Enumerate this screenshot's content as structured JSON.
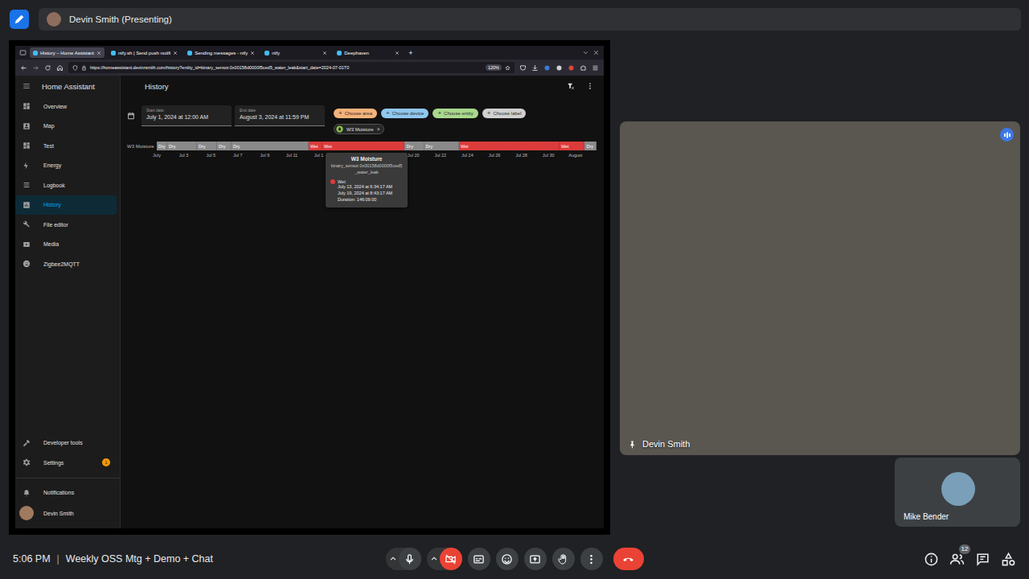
{
  "meet": {
    "presenter_chip": {
      "label": "Devin Smith (Presenting)"
    },
    "tiles": [
      {
        "name": "Devin Smith",
        "pinned": true,
        "speaking": true
      },
      {
        "name": "Mike Bender",
        "pinned": false,
        "speaking": false
      }
    ],
    "bottom_bar": {
      "time": "5:06 PM",
      "separator": "|",
      "meeting_title": "Weekly OSS Mtg + Demo + Chat",
      "mic_on": true,
      "camera_on": false,
      "participants_count": "12"
    }
  },
  "browser": {
    "tabs": [
      {
        "label": "History – Home Assistant",
        "selected": true
      },
      {
        "label": "ntfy.sh | Send push notifi",
        "selected": false
      },
      {
        "label": "Sending messages - ntfy",
        "selected": false
      },
      {
        "label": "ntfy",
        "selected": false
      },
      {
        "label": "Deephaven",
        "selected": false
      }
    ],
    "new_tab": "+",
    "url": "https://homeassistant.devinrsmith.com/history?entity_id=binary_sensor.0x00158d0000f5ced5_water_leak&start_date=2024-07-01T0",
    "zoom": "120%"
  },
  "home_assistant": {
    "title": "Home Assistant",
    "sidebar": {
      "items": [
        {
          "label": "Overview",
          "selected": false
        },
        {
          "label": "Map",
          "selected": false
        },
        {
          "label": "Test",
          "selected": false
        },
        {
          "label": "Energy",
          "selected": false
        },
        {
          "label": "Logbook",
          "selected": false
        },
        {
          "label": "History",
          "selected": true
        },
        {
          "label": "File editor",
          "selected": false
        },
        {
          "label": "Media",
          "selected": false
        },
        {
          "label": "Zigbee2MQTT",
          "selected": false
        }
      ],
      "bottom_items": [
        {
          "label": "Developer tools",
          "selected": false
        },
        {
          "label": "Settings",
          "selected": false,
          "badge": "1"
        }
      ],
      "notifications": "Notifications",
      "user": {
        "name": "Devin Smith"
      }
    },
    "header": {
      "title": "History"
    },
    "start_date": {
      "label": "Start date",
      "value": "July 1, 2024 at 12:00 AM"
    },
    "end_date": {
      "label": "End date",
      "value": "August 3, 2024 at 11:59 PM"
    },
    "filters": {
      "add_icon": "+",
      "chips": [
        {
          "label": "Choose area",
          "color": "#f5b27a"
        },
        {
          "label": "Choose device",
          "color": "#8fc7ee"
        },
        {
          "label": "Choose entity",
          "color": "#a9d98c"
        },
        {
          "label": "Choose label",
          "color": "#d0d0d0"
        }
      ]
    },
    "selected_entities": [
      {
        "label": "W3 Moisture",
        "remove_icon": "×"
      }
    ],
    "timeline": {
      "entity": "W3 Moisture",
      "axis": {
        "start_day": 0,
        "end_day": 32.56
      },
      "segments": [
        {
          "state": "Dry",
          "start": 0,
          "end": 0.77,
          "color": "#8a8a8a"
        },
        {
          "state": "Dry",
          "start": 0.77,
          "end": 2.98,
          "color": "#8a8a8a"
        },
        {
          "state": "Dry",
          "start": 2.98,
          "end": 4.46,
          "color": "#8a8a8a"
        },
        {
          "state": "Dry",
          "start": 4.46,
          "end": 5.54,
          "color": "#8a8a8a"
        },
        {
          "state": "Dry",
          "start": 5.54,
          "end": 11.25,
          "color": "#8a8a8a"
        },
        {
          "state": "Wet",
          "start": 11.25,
          "end": 12.27,
          "color": "#dc3b3b"
        },
        {
          "state": "Wet",
          "start": 12.27,
          "end": 18.36,
          "color": "#dc3b3b"
        },
        {
          "state": "Dry",
          "start": 18.36,
          "end": 19.8,
          "color": "#8a8a8a"
        },
        {
          "state": "Dry",
          "start": 19.8,
          "end": 22.38,
          "color": "#8a8a8a"
        },
        {
          "state": "Wet",
          "start": 22.38,
          "end": 29.82,
          "color": "#dc3b3b"
        },
        {
          "state": "Wet",
          "start": 29.82,
          "end": 31.7,
          "color": "#dc3b3b"
        },
        {
          "state": "Dry",
          "start": 31.7,
          "end": 32.56,
          "color": "#8a8a8a"
        }
      ],
      "ticks": [
        {
          "label": "July",
          "day": 0
        },
        {
          "label": "Jul 3",
          "day": 2
        },
        {
          "label": "Jul 5",
          "day": 4
        },
        {
          "label": "Jul 7",
          "day": 6
        },
        {
          "label": "Jul 9",
          "day": 8
        },
        {
          "label": "Jul 11",
          "day": 10
        },
        {
          "label": "Jul 1",
          "day": 12
        },
        {
          "label": "Jul 20",
          "day": 19
        },
        {
          "label": "Jul 22",
          "day": 21
        },
        {
          "label": "Jul 24",
          "day": 23
        },
        {
          "label": "Jul 26",
          "day": 25
        },
        {
          "label": "Jul 28",
          "day": 27
        },
        {
          "label": "Jul 30",
          "day": 29
        },
        {
          "label": "August",
          "day": 31
        }
      ]
    },
    "tooltip": {
      "title": "W3 Moisture",
      "entity": "binary_sensor.0x00158d0000f5ced5_water_leak",
      "state": "Wet",
      "state_color": "#dc3b3b",
      "start": "July 13, 2024 at 6:34:17 AM",
      "end": "July 19, 2024 at 8:43:17 AM",
      "duration": "Duration: 146:09:00"
    }
  }
}
